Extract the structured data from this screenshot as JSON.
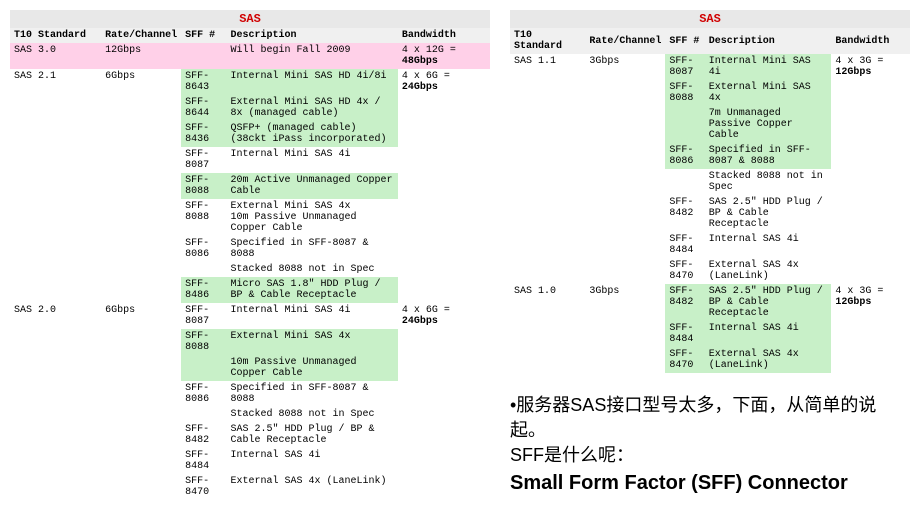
{
  "left": {
    "title": "SAS",
    "headers": [
      "T10 Standard",
      "Rate/Channel",
      "SFF #",
      "Description",
      "Bandwidth"
    ],
    "chart_data": {
      "type": "table",
      "rows": [
        {
          "std": "SAS 3.0",
          "rate": "12Gbps",
          "sff": "",
          "desc": "Will begin Fall 2009",
          "bw": "4 x 12G = 48Gbps",
          "cls": "pink"
        },
        {
          "std": "SAS 2.1",
          "rate": "6Gbps",
          "sff": "SFF-8643",
          "desc": "Internal Mini SAS HD 4i/8i",
          "bw": "4 x 6G = 24Gbps",
          "cls": "green"
        },
        {
          "std": "",
          "rate": "",
          "sff": "SFF-8644",
          "desc": "External Mini SAS HD 4x / 8x (managed cable)",
          "bw": "",
          "cls": "green"
        },
        {
          "std": "",
          "rate": "",
          "sff": "SFF-8436",
          "desc": "QSFP+ (managed cable) (38ckt iPass incorporated)",
          "bw": "",
          "cls": "green"
        },
        {
          "std": "",
          "rate": "",
          "sff": "SFF-8087",
          "desc": "Internal Mini SAS 4i",
          "bw": "",
          "cls": ""
        },
        {
          "std": "",
          "rate": "",
          "sff": "SFF-8088",
          "desc": "20m Active Unmanaged Copper Cable",
          "bw": "",
          "cls": "green"
        },
        {
          "std": "",
          "rate": "",
          "sff": "SFF-8088",
          "desc": "External Mini SAS 4x\n10m Passive Unmanaged Copper Cable",
          "bw": "",
          "cls": ""
        },
        {
          "std": "",
          "rate": "",
          "sff": "SFF-8086",
          "desc": "Specified in SFF-8087 & 8088",
          "bw": "",
          "cls": ""
        },
        {
          "std": "",
          "rate": "",
          "sff": "",
          "desc": "Stacked 8088 not in Spec",
          "bw": "",
          "cls": ""
        },
        {
          "std": "",
          "rate": "",
          "sff": "SFF-8486",
          "desc": "Micro SAS 1.8\" HDD Plug / BP & Cable Receptacle",
          "bw": "",
          "cls": "green"
        },
        {
          "std": "SAS 2.0",
          "rate": "6Gbps",
          "sff": "SFF-8087",
          "desc": "Internal Mini SAS 4i",
          "bw": "4 x 6G = 24Gbps",
          "cls": ""
        },
        {
          "std": "",
          "rate": "",
          "sff": "SFF-8088",
          "desc": "External Mini SAS 4x",
          "bw": "",
          "cls": "green"
        },
        {
          "std": "",
          "rate": "",
          "sff": "",
          "desc": "10m Passive Unmanaged Copper Cable",
          "bw": "",
          "cls": "green"
        },
        {
          "std": "",
          "rate": "",
          "sff": "SFF-8086",
          "desc": "Specified in SFF-8087 & 8088",
          "bw": "",
          "cls": ""
        },
        {
          "std": "",
          "rate": "",
          "sff": "",
          "desc": "Stacked 8088 not in Spec",
          "bw": "",
          "cls": ""
        },
        {
          "std": "",
          "rate": "",
          "sff": "SFF-8482",
          "desc": "SAS 2.5\" HDD Plug / BP & Cable Receptacle",
          "bw": "",
          "cls": ""
        },
        {
          "std": "",
          "rate": "",
          "sff": "SFF-8484",
          "desc": "Internal SAS 4i",
          "bw": "",
          "cls": ""
        },
        {
          "std": "",
          "rate": "",
          "sff": "SFF-8470",
          "desc": "External SAS 4x (LaneLink)",
          "bw": "",
          "cls": ""
        }
      ]
    }
  },
  "right": {
    "title": "SAS",
    "headers": [
      "T10 Standard",
      "Rate/Channel",
      "SFF #",
      "Description",
      "Bandwidth"
    ],
    "chart_data": {
      "type": "table",
      "rows": [
        {
          "std": "SAS 1.1",
          "rate": "3Gbps",
          "sff": "SFF-8087",
          "desc": "Internal Mini SAS 4i",
          "bw": "4 x 3G = 12Gbps",
          "cls": "green"
        },
        {
          "std": "",
          "rate": "",
          "sff": "SFF-8088",
          "desc": "External Mini SAS 4x",
          "bw": "",
          "cls": "green"
        },
        {
          "std": "",
          "rate": "",
          "sff": "",
          "desc": "7m Unmanaged  Passive Copper Cable",
          "bw": "",
          "cls": "green"
        },
        {
          "std": "",
          "rate": "",
          "sff": "SFF-8086",
          "desc": "Specified in SFF-8087 & 8088",
          "bw": "",
          "cls": "green"
        },
        {
          "std": "",
          "rate": "",
          "sff": "",
          "desc": "Stacked 8088 not in Spec",
          "bw": "",
          "cls": ""
        },
        {
          "std": "",
          "rate": "",
          "sff": "SFF-8482",
          "desc": "SAS 2.5\" HDD Plug / BP & Cable Receptacle",
          "bw": "",
          "cls": ""
        },
        {
          "std": "",
          "rate": "",
          "sff": "SFF-8484",
          "desc": "Internal SAS 4i",
          "bw": "",
          "cls": ""
        },
        {
          "std": "",
          "rate": "",
          "sff": "SFF-8470",
          "desc": "External SAS 4x (LaneLink)",
          "bw": "",
          "cls": ""
        },
        {
          "std": "SAS 1.0",
          "rate": "3Gbps",
          "sff": "SFF-8482",
          "desc": "SAS 2.5\" HDD Plug / BP & Cable Receptacle",
          "bw": "4 x 3G = 12Gbps",
          "cls": "green"
        },
        {
          "std": "",
          "rate": "",
          "sff": "SFF-8484",
          "desc": "Internal SAS 4i",
          "bw": "",
          "cls": "green"
        },
        {
          "std": "",
          "rate": "",
          "sff": "SFF-8470",
          "desc": "External SAS 4x (LaneLink)",
          "bw": "",
          "cls": "green"
        }
      ]
    }
  },
  "annotation": {
    "line1": "•服务器SAS接口型号太多，下面，从简单的说起。",
    "line2": "SFF是什么呢：",
    "line3": "Small Form Factor (SFF) Connector"
  }
}
